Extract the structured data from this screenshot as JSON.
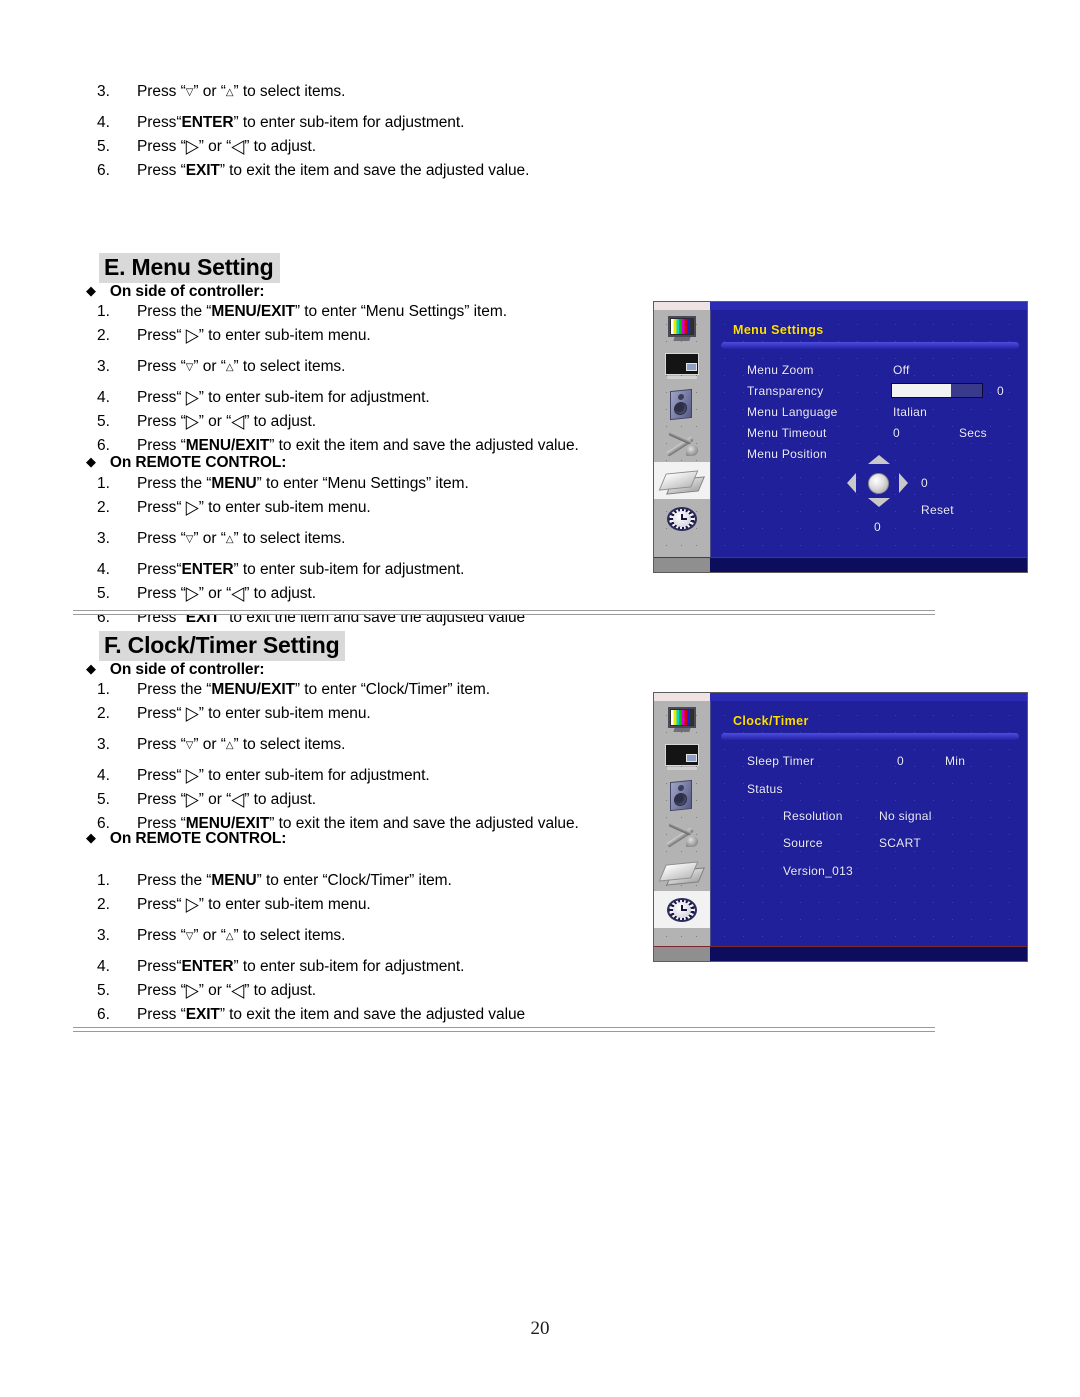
{
  "page": {
    "number": "20"
  },
  "top_steps": [
    {
      "num": "3.",
      "pre": "Press “",
      "g1": "▽",
      "mid": "” or “",
      "g2": "△",
      "post": "” to select items.",
      "bold": ""
    },
    {
      "num": "4.",
      "text_a": "Press“",
      "bold": "ENTER",
      "text_b": "” to enter sub-item for adjustment."
    },
    {
      "num": "5.",
      "pre": "Press “",
      "g1": "▷",
      "mid": "” or “",
      "g2": "◁",
      "post": "” to adjust."
    },
    {
      "num": "6.",
      "text_a": "Press “",
      "bold": "EXIT",
      "text_b": "” to exit the item and save the adjusted value."
    }
  ],
  "section_e": {
    "heading": "E. Menu Setting",
    "bullet_side": "On side of controller:",
    "bullet_remote": "On REMOTE CONTROL:",
    "side_steps": [
      {
        "num": "1.",
        "text_a": "Press the “",
        "bold": "MENU/EXIT",
        "text_b": "” to enter “Menu Settings” item."
      },
      {
        "num": "2.",
        "pre": "Press“ ",
        "g1": "▷",
        "post": "” to enter sub-item menu."
      },
      {
        "num": "3.",
        "pre": "Press “",
        "g1": "▽",
        "mid": "” or “",
        "g2": "△",
        "post": "” to select items."
      },
      {
        "num": "4.",
        "pre": "Press“ ",
        "g1": "▷",
        "post": "” to enter sub-item for adjustment."
      },
      {
        "num": "5.",
        "pre": "Press “",
        "g1": "▷",
        "mid": "” or “",
        "g2": "◁",
        "post": "” to adjust."
      },
      {
        "num": "6.",
        "text_a": "Press “",
        "bold": "MENU/EXIT",
        "text_b": "” to exit the item and save the adjusted value."
      }
    ],
    "remote_steps": [
      {
        "num": "1.",
        "text_a": "Press the “",
        "bold": "MENU",
        "text_b": "” to enter “Menu Settings” item."
      },
      {
        "num": "2.",
        "pre": "Press“ ",
        "g1": "▷",
        "post": "” to enter sub-item menu."
      },
      {
        "num": "3.",
        "pre": "Press “",
        "g1": "▽",
        "mid": "” or “",
        "g2": "△",
        "post": "” to select items."
      },
      {
        "num": "4.",
        "text_a": "Press“",
        "bold": "ENTER",
        "text_b": "” to enter sub-item for adjustment."
      },
      {
        "num": "5.",
        "pre": "Press “",
        "g1": "▷",
        "mid": "” or “",
        "g2": "◁",
        "post": "” to adjust."
      },
      {
        "num": "6.",
        "text_a": "Press “",
        "bold": "EXIT",
        "text_b": "” to exit the item and save the adjusted value"
      }
    ]
  },
  "section_f": {
    "heading": "F. Clock/Timer Setting",
    "bullet_side": "On side of controller:",
    "bullet_remote": "On REMOTE CONTROL:",
    "side_steps": [
      {
        "num": "1.",
        "text_a": "Press the “",
        "bold": "MENU/EXIT",
        "text_b": "” to enter “Clock/Timer” item."
      },
      {
        "num": "2.",
        "pre": "Press“ ",
        "g1": "▷",
        "post": "” to enter sub-item menu."
      },
      {
        "num": "3.",
        "pre": "Press “",
        "g1": "▽",
        "mid": "” or “",
        "g2": "△",
        "post": "” to select items."
      },
      {
        "num": "4.",
        "pre": "Press“ ",
        "g1": "▷",
        "post": "” to enter sub-item for adjustment."
      },
      {
        "num": "5.",
        "pre": "Press “",
        "g1": "▷",
        "mid": "” or “",
        "g2": "◁",
        "post": "” to adjust."
      },
      {
        "num": "6.",
        "text_a": "Press “",
        "bold": "MENU/EXIT",
        "text_b": "” to exit the item and save the adjusted value."
      }
    ],
    "remote_steps": [
      {
        "num": "1.",
        "text_a": "Press the “",
        "bold": "MENU",
        "text_b": "” to enter “Clock/Timer” item."
      },
      {
        "num": "2.",
        "pre": "Press“ ",
        "g1": "▷",
        "post": "” to enter sub-item menu."
      },
      {
        "num": "3.",
        "pre": "Press “",
        "g1": "▽",
        "mid": "” or “",
        "g2": "△",
        "post": "” to select items."
      },
      {
        "num": "4.",
        "text_a": "Press“",
        "bold": "ENTER",
        "text_b": "” to enter sub-item for adjustment."
      },
      {
        "num": "5.",
        "pre": "Press “",
        "g1": "▷",
        "mid": "” or “",
        "g2": "◁",
        "post": "” to adjust."
      },
      {
        "num": "6.",
        "text_a": "Press “",
        "bold": "EXIT",
        "text_b": "” to exit the item and save the adjusted value"
      }
    ]
  },
  "osd_menu_settings": {
    "title": "Menu Settings",
    "rows": [
      {
        "label": "Menu Zoom",
        "value": "Off"
      },
      {
        "label": "Transparency",
        "value": "0"
      },
      {
        "label": "Menu Language",
        "value": "Italian"
      },
      {
        "label": "Menu Timeout",
        "value": "0",
        "unit": "Secs"
      },
      {
        "label": "Menu Position",
        "value": ""
      }
    ],
    "position_h_value": "0",
    "position_v_value": "0",
    "reset_label": "Reset",
    "transparency_percent": 65,
    "colors": {
      "background": "#20209a",
      "title": "#ffe000",
      "sidebar": "#b3b3b3"
    },
    "sidebar_icons": [
      "picture-icon",
      "screen-icon",
      "sound-icon",
      "tools-icon",
      "menu-icon",
      "clock-icon"
    ],
    "selected_icon_index": 4
  },
  "osd_clock_timer": {
    "title": "Clock/Timer",
    "rows": [
      {
        "label": "Sleep Timer",
        "value": "0",
        "unit": "Min"
      },
      {
        "label": "Status",
        "value": ""
      }
    ],
    "status_rows": [
      {
        "label": "Resolution",
        "value": "No signal"
      },
      {
        "label": "Source",
        "value": "SCART"
      }
    ],
    "version": "Version_013",
    "colors": {
      "background": "#20209a",
      "title": "#ffe000",
      "sidebar": "#b3b3b3"
    },
    "sidebar_icons": [
      "picture-icon",
      "screen-icon",
      "sound-icon",
      "tools-icon",
      "menu-icon",
      "clock-icon"
    ],
    "selected_icon_index": 5
  }
}
